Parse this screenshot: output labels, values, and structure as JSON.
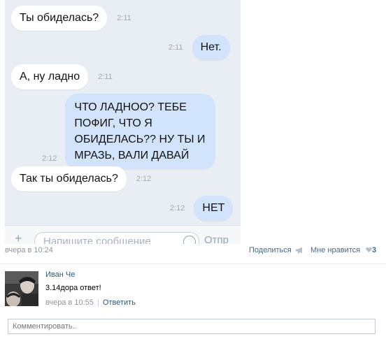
{
  "chat": {
    "messages": [
      {
        "side": "in",
        "text": "Ты обиделась?",
        "time": "2:11"
      },
      {
        "side": "out",
        "text": "Нет.",
        "time": "2:11"
      },
      {
        "side": "in",
        "text": "А, ну ладно",
        "time": "2:11"
      },
      {
        "side": "out",
        "lines": [
          "ЧТО ЛАДНОО? ТЕБЕ",
          "ПОФИГ, ЧТО Я",
          "ОБИДЕЛАСЬ?? НУ ТЫ И",
          "МРАЗЬ, ВАЛИ ДАВАЙ"
        ],
        "time": "2:12"
      },
      {
        "side": "in",
        "text": "Так ты обиделась?",
        "time": "2:12"
      },
      {
        "side": "out",
        "text": "НЕТ",
        "time": "2:12"
      }
    ],
    "composer": {
      "placeholder": "Напишите сообщение",
      "send_label": "Отпр",
      "plus_icon": "plus-icon",
      "smile_icon": "smile-icon"
    }
  },
  "post": {
    "date": "вчера в 10:24",
    "share_label": "Поделиться",
    "like_label": "Мне нравится",
    "likes_count": "3",
    "share_icon": "megaphone-icon",
    "heart_icon": "heart-icon"
  },
  "comment": {
    "author": "Иван Че",
    "text": "3.14дора ответ!",
    "date": "вчера в 10:55",
    "divider": "|",
    "reply_label": "Ответить"
  },
  "comment_input": {
    "placeholder": "Комментировать.."
  },
  "colors": {
    "chat_bg": "#e9eef4",
    "bubble_in": "#ffffff",
    "bubble_out": "#d1e4fb",
    "link": "#2b587a"
  }
}
